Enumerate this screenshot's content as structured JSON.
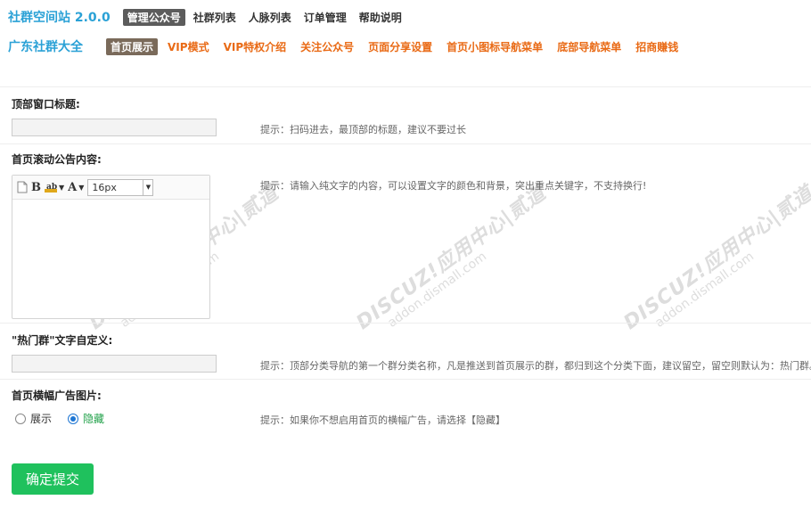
{
  "header": {
    "app_title": "社群空间站 2.0.0",
    "nav": [
      {
        "label": "管理公众号",
        "active": true
      },
      {
        "label": "社群列表",
        "active": false
      },
      {
        "label": "人脉列表",
        "active": false
      },
      {
        "label": "订单管理",
        "active": false
      },
      {
        "label": "帮助说明",
        "active": false
      }
    ]
  },
  "subnav": {
    "site_name": "广东社群大全",
    "items": [
      {
        "label": "首页展示",
        "active": true
      },
      {
        "label": "VIP模式",
        "active": false
      },
      {
        "label": "VIP特权介绍",
        "active": false
      },
      {
        "label": "关注公众号",
        "active": false
      },
      {
        "label": "页面分享设置",
        "active": false
      },
      {
        "label": "首页小图标导航菜单",
        "active": false
      },
      {
        "label": "底部导航菜单",
        "active": false
      },
      {
        "label": "招商赚钱",
        "active": false
      }
    ]
  },
  "form": {
    "top_title": {
      "label": "顶部窗口标题:",
      "value": "",
      "tip": "提示：扫码进去，最顶部的标题，建议不要过长"
    },
    "scroll_notice": {
      "label": "首页滚动公告内容:",
      "font_size": "16px",
      "tip": "提示：请输入纯文字的内容，可以设置文字的颜色和背景，突出重点关键字，不支持换行!"
    },
    "hot_group": {
      "label": "\"热门群\"文字自定义:",
      "value": "",
      "tip": "提示：顶部分类导航的第一个群分类名称，凡是推送到首页展示的群，都归到这个分类下面，建议留空，留空则默认为：热门群。"
    },
    "banner": {
      "label": "首页横幅广告图片:",
      "options": [
        "展示",
        "隐藏"
      ],
      "selected": "隐藏",
      "tip": "提示：如果你不想启用首页的横幅广告，请选择【隐藏】"
    },
    "submit_label": "确定提交"
  },
  "watermark": {
    "line1": "DISCUZ!应用中心|贰道",
    "line2": "addon.dismall.com"
  },
  "colors": {
    "accent": "#2aa1d6",
    "orange": "#e96a15",
    "submit": "#1fc15d",
    "radio": "#1e76d3"
  }
}
